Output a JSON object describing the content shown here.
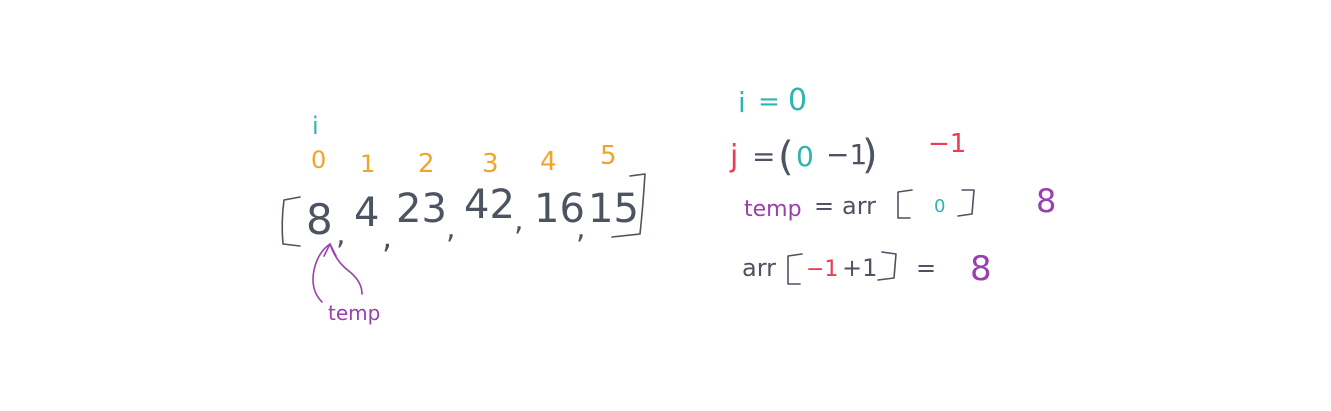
{
  "colors": {
    "background": "#ffffff",
    "teal": "#2fb5b0",
    "orange": "#f2a42a",
    "gray": "#4d5360",
    "red": "#ec3a57",
    "purple": "#9a3fae"
  },
  "array_diagram": {
    "pointer_label": "i",
    "indices": [
      "0",
      "1",
      "2",
      "3",
      "4",
      "5"
    ],
    "values": [
      "8",
      "4",
      "23",
      "42",
      "16",
      "15"
    ],
    "separator": ",",
    "temp_label": "temp"
  },
  "work": {
    "line1": {
      "var": "i",
      "eq": "=",
      "value": "0"
    },
    "line2": {
      "var": "j",
      "eq": "=",
      "open": "(",
      "i_value": "0",
      "minus_one": "−1",
      "close": ")",
      "result": "−1"
    },
    "line3": {
      "var": "temp",
      "eq": "=",
      "arr": "arr",
      "index": "0",
      "result": "8"
    },
    "line4": {
      "arr": "arr",
      "index_j": "−1",
      "plus_one": "+1",
      "eq": "=",
      "result": "8"
    }
  }
}
